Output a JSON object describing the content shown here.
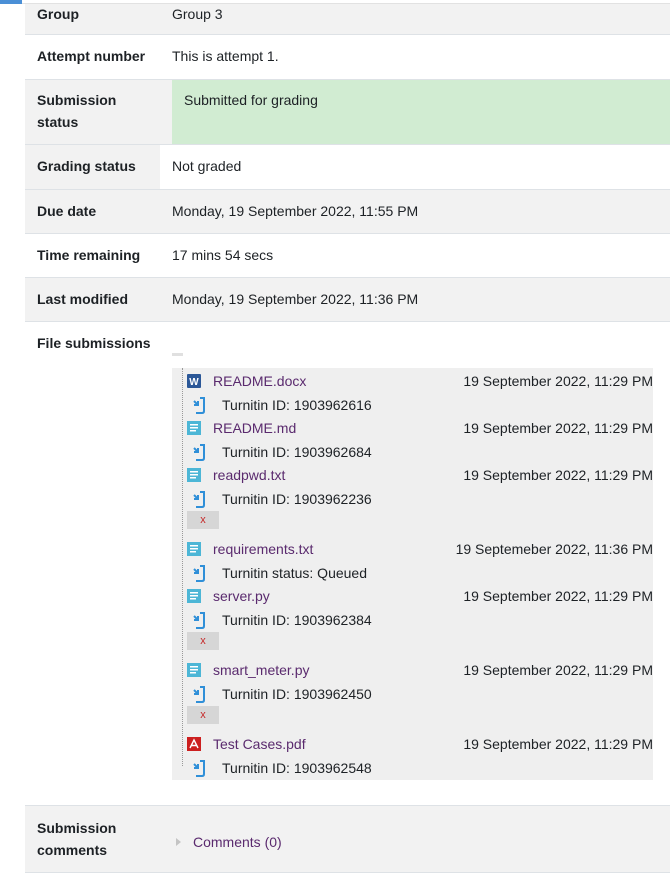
{
  "rows": {
    "group": {
      "label": "Group",
      "value": "Group 3"
    },
    "attempt": {
      "label": "Attempt number",
      "value": "This is attempt 1."
    },
    "submission_status": {
      "label": "Submission status",
      "value": "Submitted for grading"
    },
    "grading_status": {
      "label": "Grading status",
      "value": "Not graded"
    },
    "due_date": {
      "label": "Due date",
      "value": "Monday, 19 September 2022, 11:55 PM"
    },
    "time_remaining": {
      "label": "Time remaining",
      "value": "17 mins 54 secs"
    },
    "last_modified": {
      "label": "Last modified",
      "value": "Monday, 19 September 2022, 11:36 PM"
    },
    "file_submissions": {
      "label": "File submissions"
    },
    "submission_comments": {
      "label": "Submission comments",
      "link": "Comments (0)"
    }
  },
  "files": [
    {
      "name": "README.docx",
      "date": "19 September 2022, 11:29 PM",
      "icon": "word-document-icon",
      "turnitin": "Turnitin ID: 1903962616",
      "has_x": false
    },
    {
      "name": "README.md",
      "date": "19 September 2022, 11:29 PM",
      "icon": "text-file-icon",
      "turnitin": "Turnitin ID: 1903962684",
      "has_x": false
    },
    {
      "name": "readpwd.txt",
      "date": "19 September 2022, 11:29 PM",
      "icon": "text-file-icon",
      "turnitin": "Turnitin ID: 1903962236",
      "has_x": true
    },
    {
      "name": "requirements.txt",
      "date": "19 Septemeber 2022, 11:36 PM",
      "icon": "text-file-icon",
      "turnitin": "Turnitin status: Queued",
      "has_x": false
    },
    {
      "name": "server.py",
      "date": "19 September 2022, 11:29 PM",
      "icon": "text-file-icon",
      "turnitin": "Turnitin ID: 1903962384",
      "has_x": true
    },
    {
      "name": "smart_meter.py",
      "date": "19 September 2022, 11:29 PM",
      "icon": "text-file-icon",
      "turnitin": "Turnitin ID: 1903962450",
      "has_x": true
    },
    {
      "name": "Test Cases.pdf",
      "date": "19 September 2022, 11:29 PM",
      "icon": "pdf-file-icon",
      "turnitin": "Turnitin ID: 1903962548",
      "has_x": false
    }
  ],
  "x_label": "x",
  "colors": {
    "link": "#5a2a6e",
    "status_green": "#d1ecd2",
    "row_gray": "#f2f2f2",
    "turnitin_blue": "#2f8fd8",
    "pdf_red": "#cc1f1f",
    "word_blue": "#2b5797",
    "text_file_cyan": "#4cb6d6"
  }
}
